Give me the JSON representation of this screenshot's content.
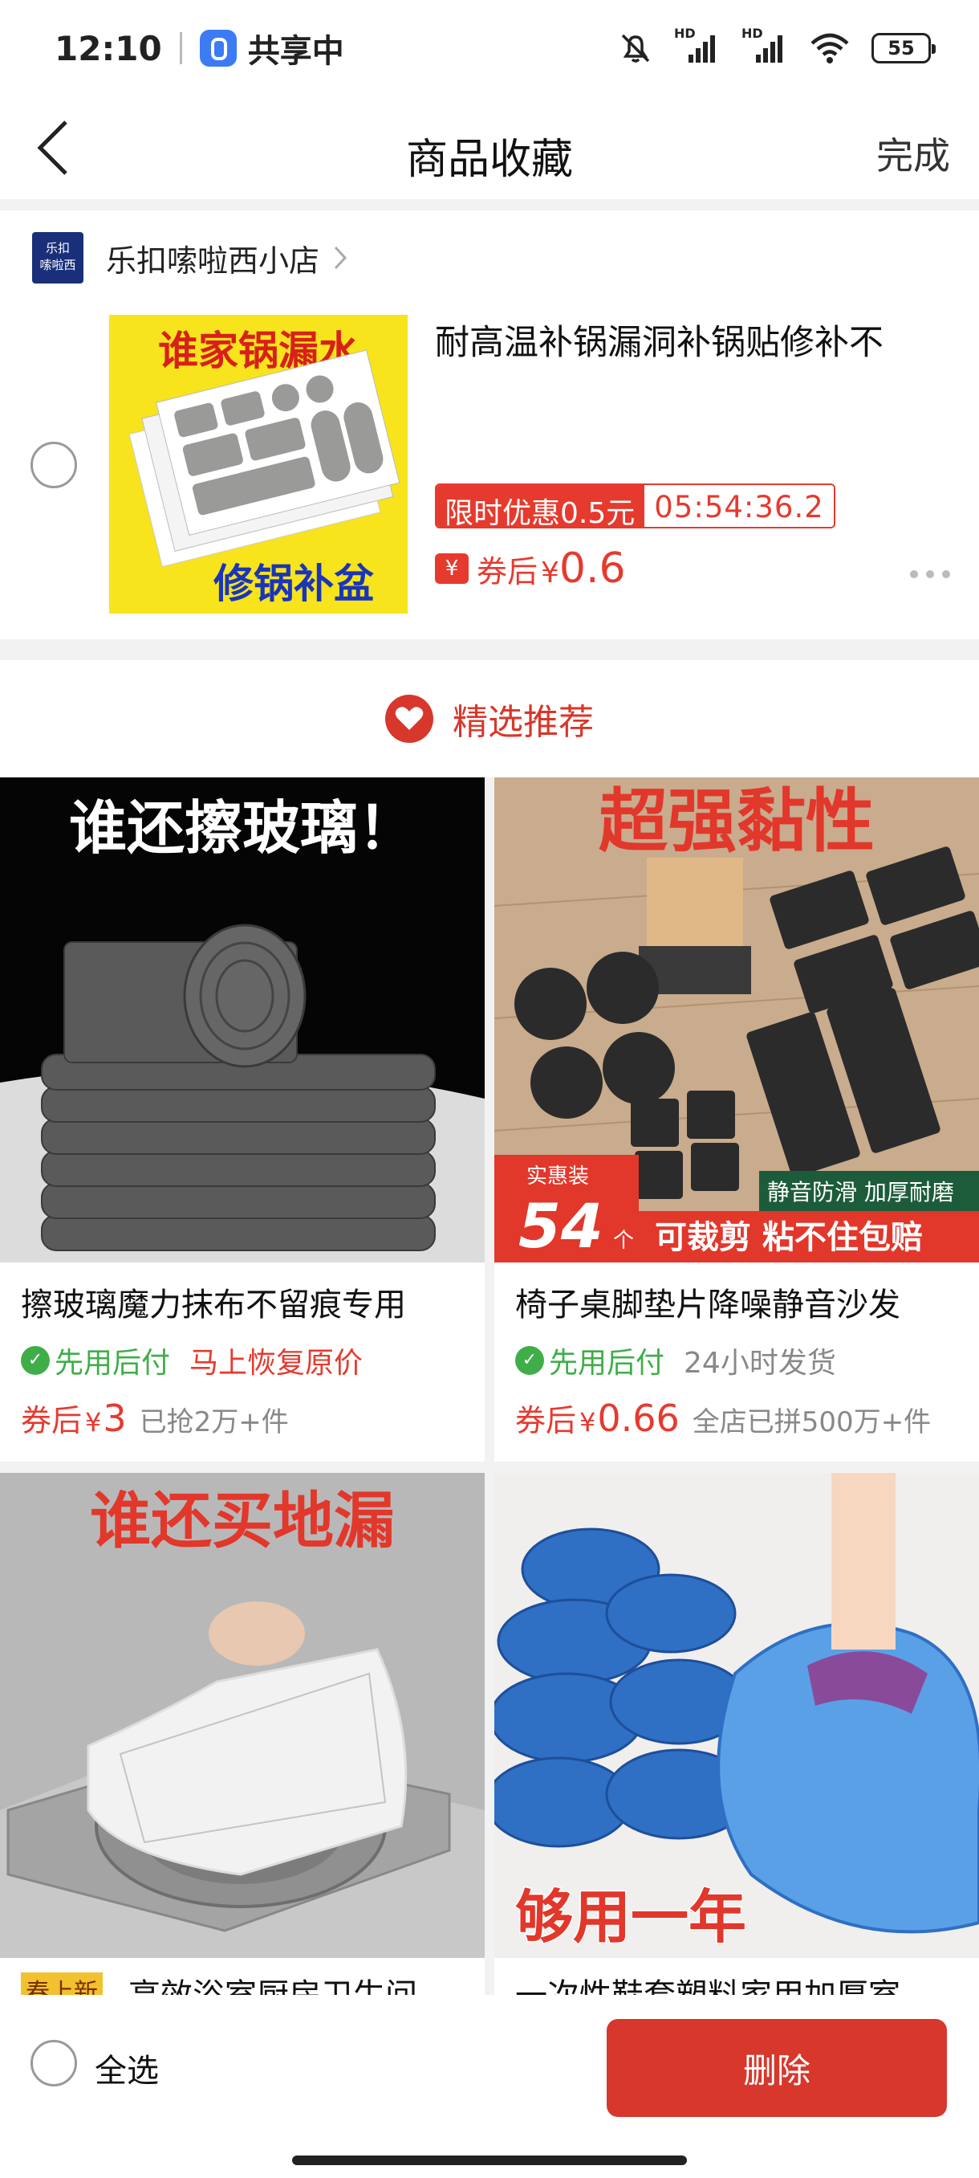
{
  "status_bar": {
    "time": "12:10",
    "share_label": "共享中",
    "battery": "55",
    "hd_1": "HD",
    "hd_2": "HD"
  },
  "nav": {
    "title": "商品收藏",
    "done_label": "完成"
  },
  "favorite": {
    "shop": {
      "logo_line1": "乐扣",
      "logo_line2": "嗦啦西",
      "name": "乐扣嗦啦西小店"
    },
    "item": {
      "image_title": "谁家锅漏水",
      "image_caption": "修锅补盆",
      "title": "耐高温补锅漏洞补锅贴修补不",
      "promo_label": "限时优惠0.5元",
      "promo_timer": "05:54:36.2",
      "coupon_icon": "¥",
      "coupon_label": "券后",
      "coupon_yen": "¥",
      "coupon_price": "0.6"
    }
  },
  "recommend": {
    "title": "精选推荐"
  },
  "products": [
    {
      "image_headline": "谁还擦玻璃！",
      "title": "擦玻璃魔力抹布不留痕专用",
      "pay_tag": "先用后付",
      "extra_tag": "马上恢复原价",
      "price_label": "券后",
      "yen": "¥",
      "price": "3",
      "sales": "已抢2万+件"
    },
    {
      "image_headline": "超强黏性",
      "image_badge_top": "实惠装",
      "image_badge_num": "54",
      "image_badge_unit": "个",
      "image_strip": "可裁剪 粘不住包赔",
      "image_corner": "静音防滑 加厚耐磨",
      "title": "椅子桌脚垫片降噪静音沙发",
      "pay_tag": "先用后付",
      "extra_tag": "24小时发货",
      "price_label": "券后",
      "yen": "¥",
      "price": "0.66",
      "sales": "全店已拼500万+件"
    },
    {
      "image_headline": "谁还买地漏",
      "badge": "春上新",
      "title": "高效浴室厨房卫生间"
    },
    {
      "image_headline": "够用一年",
      "title": "一次性鞋套塑料家用加厚室"
    }
  ],
  "bottom": {
    "select_all": "全选",
    "delete": "删除"
  },
  "colors": {
    "accent_red": "#d8372b",
    "price_red": "#e63a2e",
    "pay_green": "#3fae49"
  }
}
